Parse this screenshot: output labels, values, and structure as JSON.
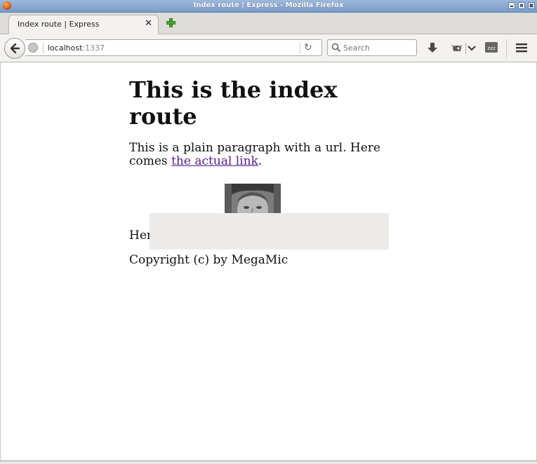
{
  "window": {
    "title": "Index route | Express - Mozilla Firefox"
  },
  "tabs": [
    {
      "label": "Index route | Express",
      "active": true
    }
  ],
  "navbar": {
    "url_host": "localhost",
    "url_port": ":1337",
    "search_placeholder": "Search"
  },
  "page": {
    "heading": "This is the index route",
    "paragraph_before_link": "This is a plain paragraph with a url. Here comes ",
    "link_text": "the actual link",
    "paragraph_after_link": ".",
    "here_text": "Her",
    "copyright": "Copyright (c) by MegaMic"
  },
  "colors": {
    "link_visited": "#551a8b",
    "titlebar": "#7b9cc8",
    "overlay": "#ecebe9"
  }
}
